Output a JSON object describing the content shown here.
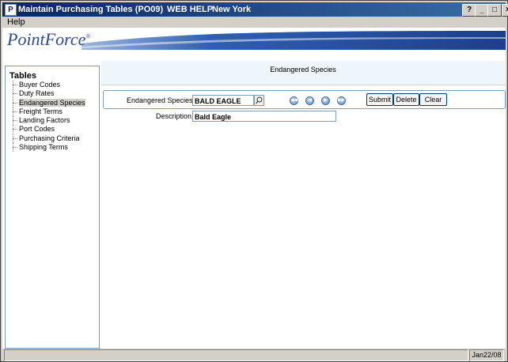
{
  "window": {
    "app_icon": "P",
    "title": "Maintain Purchasing Tables (PO09)",
    "web_help": "WEB HELP",
    "location": "New York",
    "controls": {
      "help": "?",
      "minimize": "_",
      "maximize": "□",
      "close": "×"
    }
  },
  "menu": {
    "help": "Help"
  },
  "brand": {
    "logo": "PointForce",
    "tm": "®",
    "accent": "#2a4a9a"
  },
  "sidebar": {
    "heading": "Tables",
    "items": [
      {
        "label": "Buyer Codes"
      },
      {
        "label": "Duty Rates"
      },
      {
        "label": "Endangered Species",
        "selected": true
      },
      {
        "label": "Freight Terms"
      },
      {
        "label": "Landing Factors"
      },
      {
        "label": "Port Codes"
      },
      {
        "label": "Purchasing Criteria"
      },
      {
        "label": "Shipping Terms"
      }
    ]
  },
  "main": {
    "title": "Endangered Species",
    "form": {
      "species_label": "Endangered Species",
      "species_value": "BALD EAGLE",
      "description_label": "Description",
      "description_value": "Bald Eagle"
    },
    "nav_icons": [
      "first-record-icon",
      "previous-record-icon",
      "next-record-icon",
      "last-record-icon"
    ],
    "buttons": {
      "submit": "Submit",
      "delete": "Delete",
      "clear": "Clear"
    }
  },
  "status": {
    "date": "Jan22/08"
  }
}
